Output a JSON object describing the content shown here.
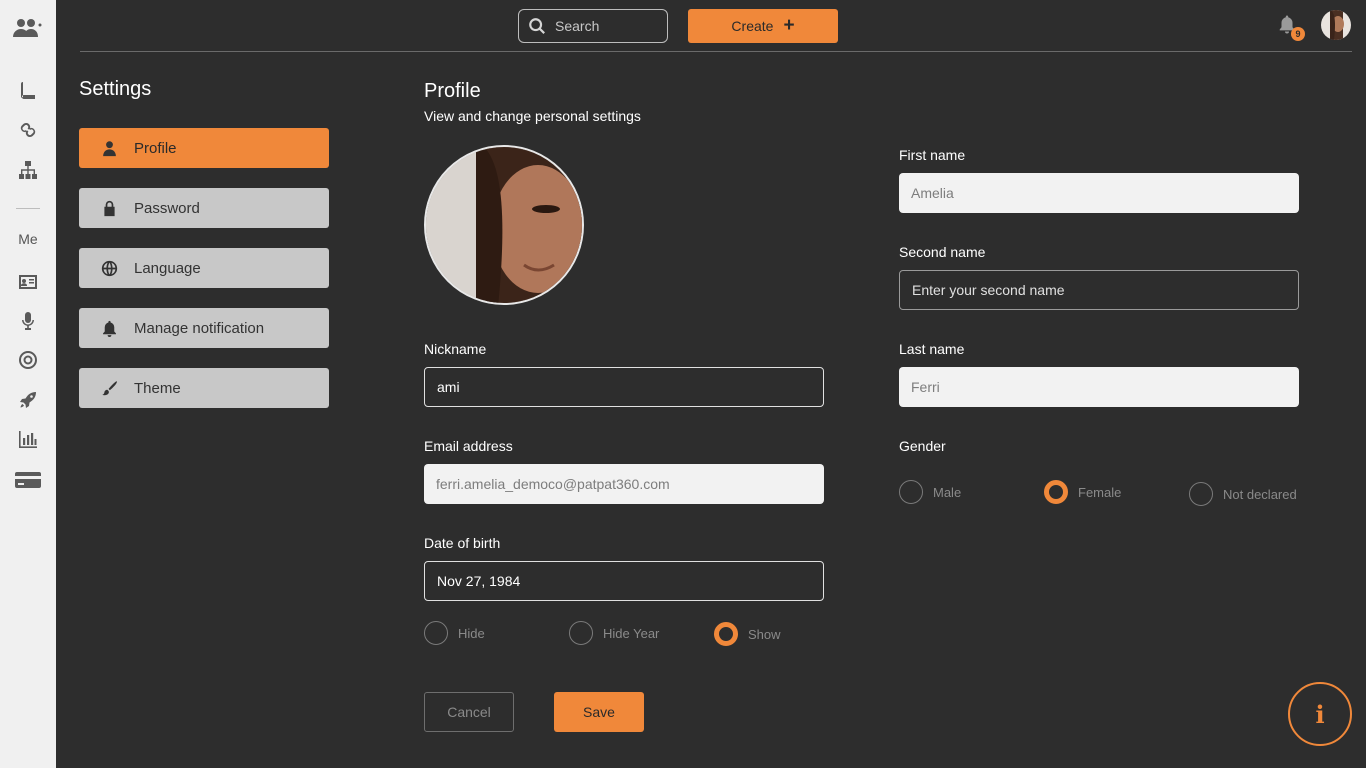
{
  "rail": {
    "icons": [
      "team-icon",
      "book-icon",
      "link-icon",
      "org-chart-icon",
      "contact-card-icon",
      "microphone-icon",
      "target-icon",
      "rocket-icon",
      "bar-chart-icon",
      "credit-card-icon"
    ],
    "section_label": "Me"
  },
  "topbar": {
    "search_placeholder": "Search",
    "create_label": "Create",
    "create_icon": "plus-icon",
    "notification_count": "9"
  },
  "settings": {
    "title": "Settings",
    "items": [
      {
        "label": "Profile",
        "icon": "user-icon",
        "active": true
      },
      {
        "label": "Password",
        "icon": "lock-icon",
        "active": false
      },
      {
        "label": "Language",
        "icon": "globe-icon",
        "active": false
      },
      {
        "label": "Manage notification",
        "icon": "bell-icon",
        "active": false
      },
      {
        "label": "Theme",
        "icon": "brush-icon",
        "active": false
      }
    ]
  },
  "profile": {
    "title": "Profile",
    "subtitle": "View and change personal settings",
    "nickname_label": "Nickname",
    "nickname_value": "ami",
    "email_label": "Email address",
    "email_value": "ferri.amelia_democo@patpat360.com",
    "dob_label": "Date of birth",
    "dob_value": "Nov 27, 1984",
    "dob_visibility": [
      {
        "label": "Hide",
        "selected": false
      },
      {
        "label": "Hide Year",
        "selected": false
      },
      {
        "label": "Show",
        "selected": true
      }
    ],
    "first_name_label": "First name",
    "first_name_value": "Amelia",
    "second_name_label": "Second name",
    "second_name_placeholder": "Enter your second name",
    "last_name_label": "Last name",
    "last_name_value": "Ferri",
    "gender_label": "Gender",
    "gender_options": [
      {
        "label": "Male",
        "selected": false
      },
      {
        "label": "Female",
        "selected": true
      },
      {
        "label": "Not declared",
        "selected": false
      }
    ],
    "cancel_label": "Cancel",
    "save_label": "Save"
  },
  "colors": {
    "accent": "#f0883a",
    "background": "#2d2d2d",
    "rail": "#f0f0f0",
    "nav_inactive": "#c8c8c8"
  }
}
